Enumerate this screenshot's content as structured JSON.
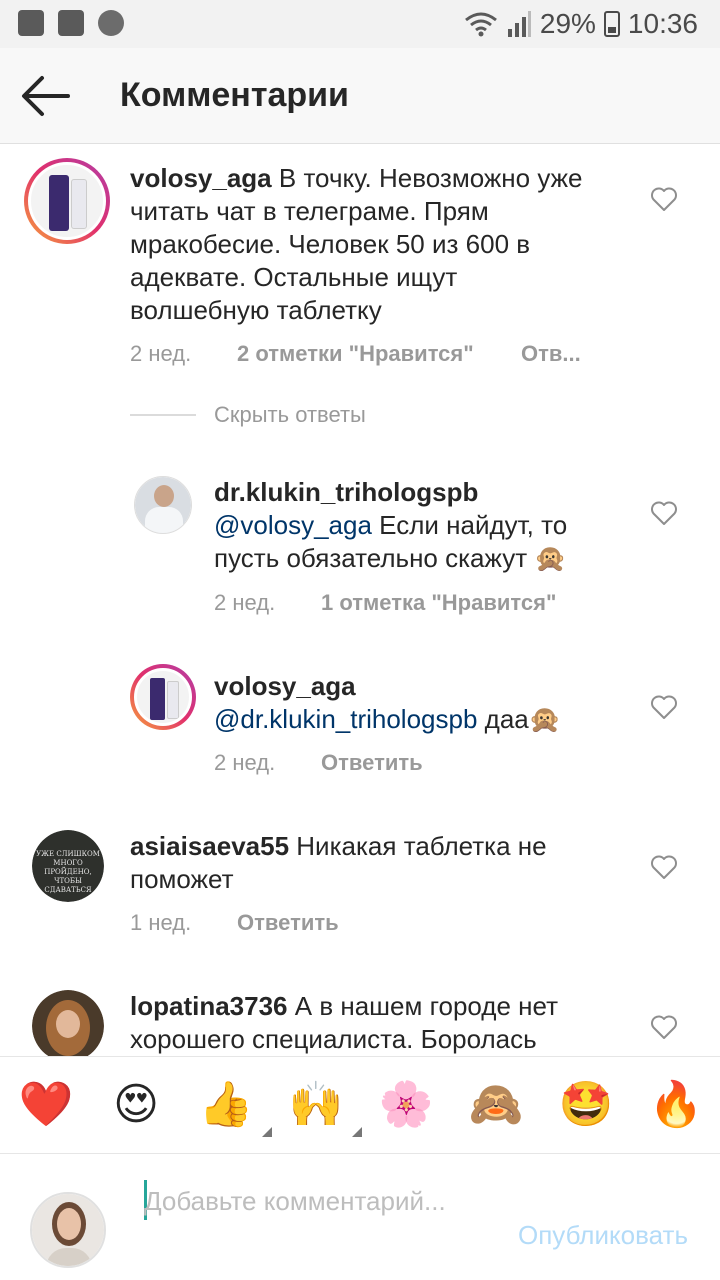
{
  "status_bar": {
    "battery": "29%",
    "time": "10:36"
  },
  "header": {
    "title": "Комментарии"
  },
  "comments": [
    {
      "user": "volosy_aga",
      "text": "В точку. Невозможно уже читать чат в телеграме. Прям мракобесие. Человек 50 из 600 в адеквате. Остальные ищут волшебную таблетку",
      "time": "2 нед.",
      "likes": "2 отметки \"Нравится\"",
      "reply": "Отв..."
    },
    {
      "user": "dr.klukin_trihologspb",
      "mention": "@volosy_aga",
      "text": "Если найдут, то пусть обязательно скажут 🙊",
      "time": "2 нед.",
      "likes": "1 отметка \"Нравится\""
    },
    {
      "user": "volosy_aga",
      "mention": "@dr.klukin_trihologspb",
      "text": "даа🙊",
      "time": "2 нед.",
      "reply": "Ответить"
    },
    {
      "user": "asiaisaeva55",
      "text": "Никакая таблетка не поможет",
      "time": "1 нед.",
      "reply": "Ответить",
      "avatar_caption": "УЖЕ СЛИШКОМ МНОГО ПРОЙДЕНО, ЧТОБЫ СДАВАТЬСЯ"
    },
    {
      "user": "lopatina3736",
      "text": "А в нашем городе нет хорошего специалиста. Боролась"
    }
  ],
  "hide_replies": "Скрыть ответы",
  "emoji_bar": [
    "❤️",
    "😍",
    "👍",
    "🙌",
    "🌸",
    "🙈",
    "🤩",
    "🔥"
  ],
  "composer": {
    "placeholder": "Добавьте комментарий...",
    "publish": "Опубликовать"
  },
  "colors": {
    "mention": "#003569",
    "publish_disabled": "#b3dbf8",
    "caret": "#26a69a"
  }
}
